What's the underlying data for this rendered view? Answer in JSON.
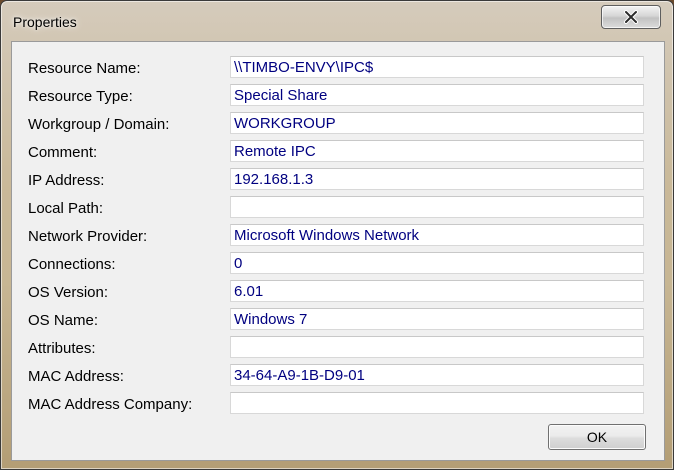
{
  "window": {
    "title": "Properties"
  },
  "fields": [
    {
      "label": "Resource Name:",
      "value": "\\\\TIMBO-ENVY\\IPC$"
    },
    {
      "label": "Resource Type:",
      "value": "Special Share"
    },
    {
      "label": "Workgroup / Domain:",
      "value": "WORKGROUP"
    },
    {
      "label": "Comment:",
      "value": "Remote IPC"
    },
    {
      "label": "IP Address:",
      "value": "192.168.1.3"
    },
    {
      "label": "Local Path:",
      "value": ""
    },
    {
      "label": "Network Provider:",
      "value": "Microsoft Windows Network"
    },
    {
      "label": "Connections:",
      "value": "0"
    },
    {
      "label": "OS Version:",
      "value": "6.01"
    },
    {
      "label": "OS Name:",
      "value": "Windows 7"
    },
    {
      "label": "Attributes:",
      "value": ""
    },
    {
      "label": "MAC Address:",
      "value": "34-64-A9-1B-D9-01"
    },
    {
      "label": "MAC Address Company:",
      "value": ""
    }
  ],
  "buttons": {
    "ok_label": "OK",
    "close_icon": "close-x-icon"
  },
  "colors": {
    "value_text": "#000080",
    "client_bg": "#f0f0f0"
  }
}
